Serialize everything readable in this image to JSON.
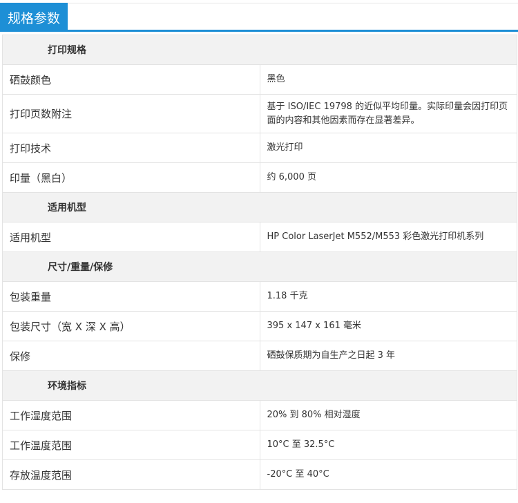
{
  "header": {
    "title": "规格参数"
  },
  "sections": [
    {
      "title": "打印规格",
      "rows": [
        {
          "label": "硒鼓颜色",
          "value": "黑色"
        },
        {
          "label": "打印页数附注",
          "value": "基于 ISO/IEC 19798 的近似平均印量。实际印量会因打印页面的内容和其他因素而存在显著差异。"
        },
        {
          "label": "打印技术",
          "value": "激光打印"
        },
        {
          "label": "印量（黑白）",
          "value": "约 6,000 页"
        }
      ]
    },
    {
      "title": "适用机型",
      "rows": [
        {
          "label": "适用机型",
          "value": "HP Color LaserJet M552/M553 彩色激光打印机系列"
        }
      ]
    },
    {
      "title": "尺寸/重量/保修",
      "rows": [
        {
          "label": "包装重量",
          "value": "1.18 千克"
        },
        {
          "label": "包装尺寸（宽 X 深 X 高）",
          "value": "395 x 147 x 161 毫米"
        },
        {
          "label": "保修",
          "value": "硒鼓保质期为自生产之日起 3 年"
        }
      ]
    },
    {
      "title": "环境指标",
      "rows": [
        {
          "label": "工作湿度范围",
          "value": "20% 到 80% 相对湿度"
        },
        {
          "label": "工作温度范围",
          "value": "10°C 至 32.5°C"
        },
        {
          "label": "存放温度范围",
          "value": "-20°C 至 40°C"
        }
      ]
    }
  ]
}
